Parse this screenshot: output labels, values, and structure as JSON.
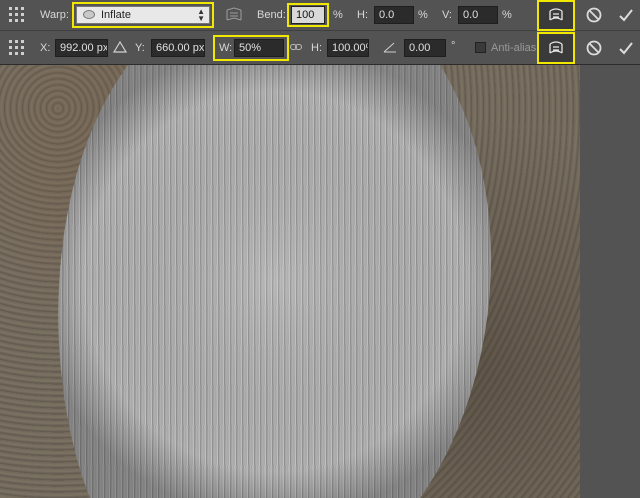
{
  "toolbar_top": {
    "warp_label": "Warp:",
    "warp_style": "Inflate",
    "bend_label": "Bend:",
    "bend_value": "100",
    "bend_unit": "%",
    "h_label": "H:",
    "h_value": "0.0",
    "h_unit": "%",
    "v_label": "V:",
    "v_value": "0.0",
    "v_unit": "%"
  },
  "toolbar_bottom": {
    "x_label": "X:",
    "x_value": "992.00 px",
    "y_label": "Y:",
    "y_value": "660.00 px",
    "w_label": "W:",
    "w_value": "50%",
    "h_label": "H:",
    "h_value": "100.00%",
    "angle_value": "0.00",
    "angle_unit": "°",
    "antialias_label": "Anti-alias"
  },
  "icons": {
    "reference_point": "reference-point-grid-icon",
    "warp_toggle": "warp-mode-icon",
    "cancel": "cancel-circle-icon",
    "commit": "checkmark-icon",
    "link": "link-chain-icon",
    "delta": "delta-triangle-icon",
    "angle": "angle-icon"
  },
  "colors": {
    "toolbar_bg": "#535353",
    "highlight": "#f0e800",
    "field_bg": "#2b2b2b"
  }
}
